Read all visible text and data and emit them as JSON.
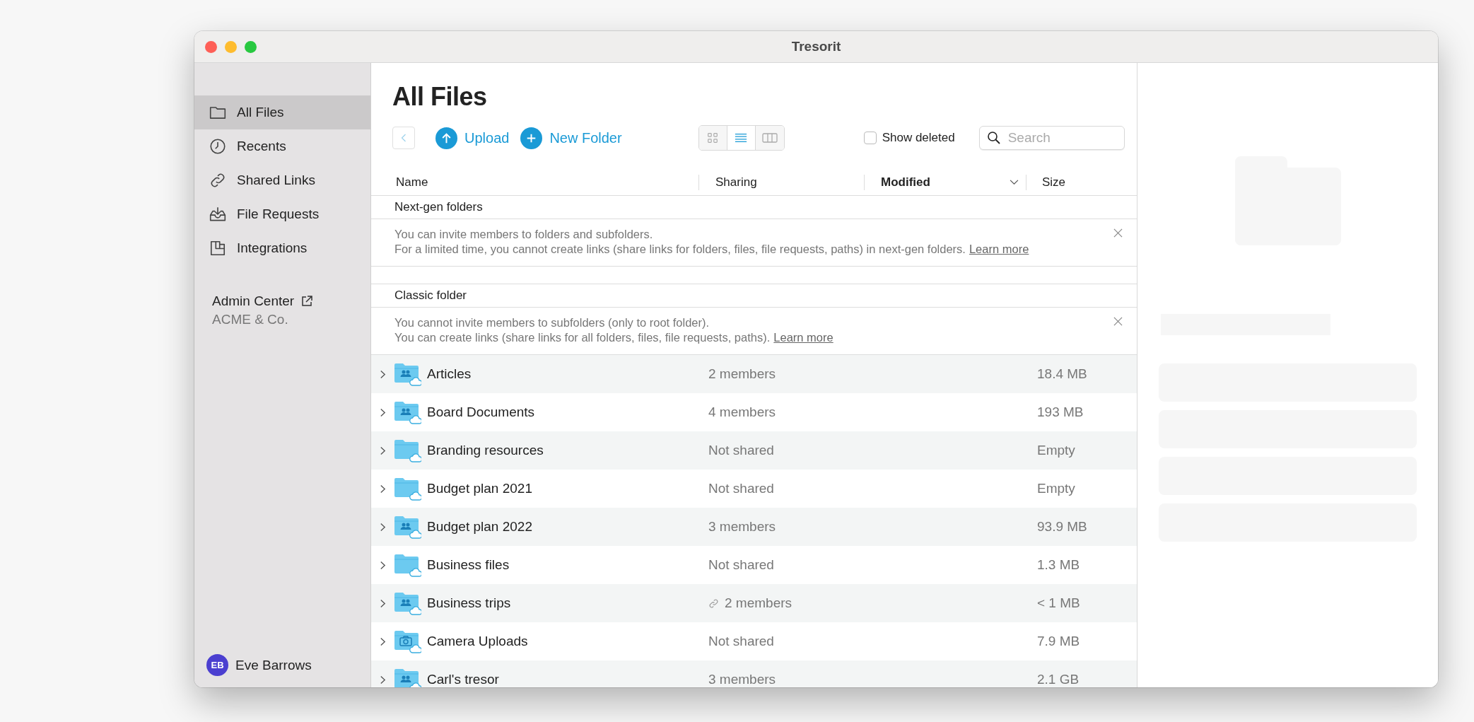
{
  "window": {
    "title": "Tresorit"
  },
  "sidebar": {
    "items": [
      {
        "label": "All Files",
        "selected": true
      },
      {
        "label": "Recents",
        "selected": false
      },
      {
        "label": "Shared Links",
        "selected": false
      },
      {
        "label": "File Requests",
        "selected": false
      },
      {
        "label": "Integrations",
        "selected": false
      }
    ],
    "admin": {
      "label": "Admin Center",
      "company": "ACME & Co."
    },
    "user": {
      "initials": "EB",
      "name": "Eve Barrows"
    }
  },
  "page": {
    "title": "All Files"
  },
  "toolbar": {
    "upload": "Upload",
    "new_folder": "New Folder",
    "views": [
      {
        "selected": false
      },
      {
        "selected": true
      },
      {
        "selected": false
      }
    ],
    "show_deleted": {
      "label": "Show deleted",
      "checked": false
    },
    "search": {
      "placeholder": "Search"
    }
  },
  "table": {
    "columns": [
      {
        "label": "Name",
        "sorted": false
      },
      {
        "label": "Sharing",
        "sorted": false
      },
      {
        "label": "Modified",
        "sorted": true
      },
      {
        "label": "Size",
        "sorted": false
      }
    ],
    "sections": [
      {
        "title": "Next-gen folders",
        "lines": [
          "You can invite members to folders and subfolders.",
          "For a limited time, you cannot create links (share links for folders, files, file requests, paths) in next-gen folders."
        ],
        "link": "Learn more"
      },
      {
        "title": "Classic folder",
        "lines": [
          "You cannot invite members to subfolders (only to root folder).",
          "You can create links (share links for all folders, files, file requests, paths)."
        ],
        "link": "Learn more"
      }
    ],
    "rows": [
      {
        "name": "Articles",
        "kind": "shared",
        "sharing": "2 members",
        "linked": false,
        "size": "18.4 MB"
      },
      {
        "name": "Board Documents",
        "kind": "shared",
        "sharing": "4 members",
        "linked": false,
        "size": "193 MB"
      },
      {
        "name": "Branding resources",
        "kind": "plain",
        "sharing": "Not shared",
        "linked": false,
        "size": "Empty"
      },
      {
        "name": "Budget plan 2021",
        "kind": "plain",
        "sharing": "Not shared",
        "linked": false,
        "size": "Empty"
      },
      {
        "name": "Budget plan 2022",
        "kind": "shared",
        "sharing": "3 members",
        "linked": false,
        "size": "93.9 MB"
      },
      {
        "name": "Business files",
        "kind": "plain",
        "sharing": "Not shared",
        "linked": false,
        "size": "1.3 MB"
      },
      {
        "name": "Business trips",
        "kind": "shared",
        "sharing": "2 members",
        "linked": true,
        "size": "< 1 MB"
      },
      {
        "name": "Camera Uploads",
        "kind": "camera",
        "sharing": "Not shared",
        "linked": false,
        "size": "7.9 MB"
      },
      {
        "name": "Carl's tresor",
        "kind": "shared",
        "sharing": "3 members",
        "linked": false,
        "size": "2.1 GB"
      }
    ]
  }
}
